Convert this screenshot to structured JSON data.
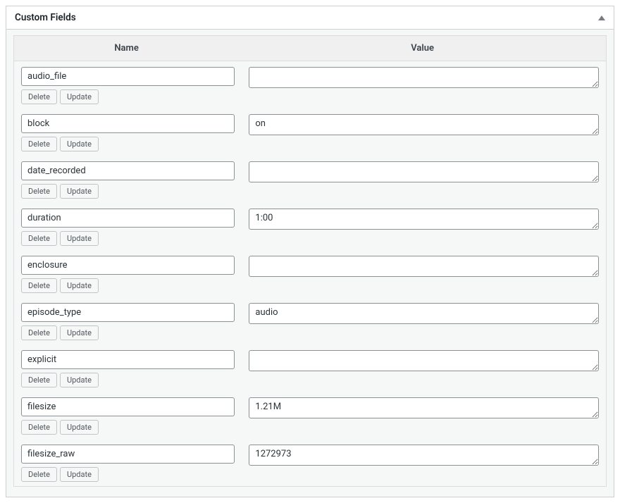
{
  "panel": {
    "title": "Custom Fields"
  },
  "headers": {
    "name": "Name",
    "value": "Value"
  },
  "buttons": {
    "delete": "Delete",
    "update": "Update"
  },
  "fields": [
    {
      "name": "audio_file",
      "value": ""
    },
    {
      "name": "block",
      "value": "on"
    },
    {
      "name": "date_recorded",
      "value": ""
    },
    {
      "name": "duration",
      "value": "1:00"
    },
    {
      "name": "enclosure",
      "value": ""
    },
    {
      "name": "episode_type",
      "value": "audio"
    },
    {
      "name": "explicit",
      "value": ""
    },
    {
      "name": "filesize",
      "value": "1.21M"
    },
    {
      "name": "filesize_raw",
      "value": "1272973"
    }
  ]
}
